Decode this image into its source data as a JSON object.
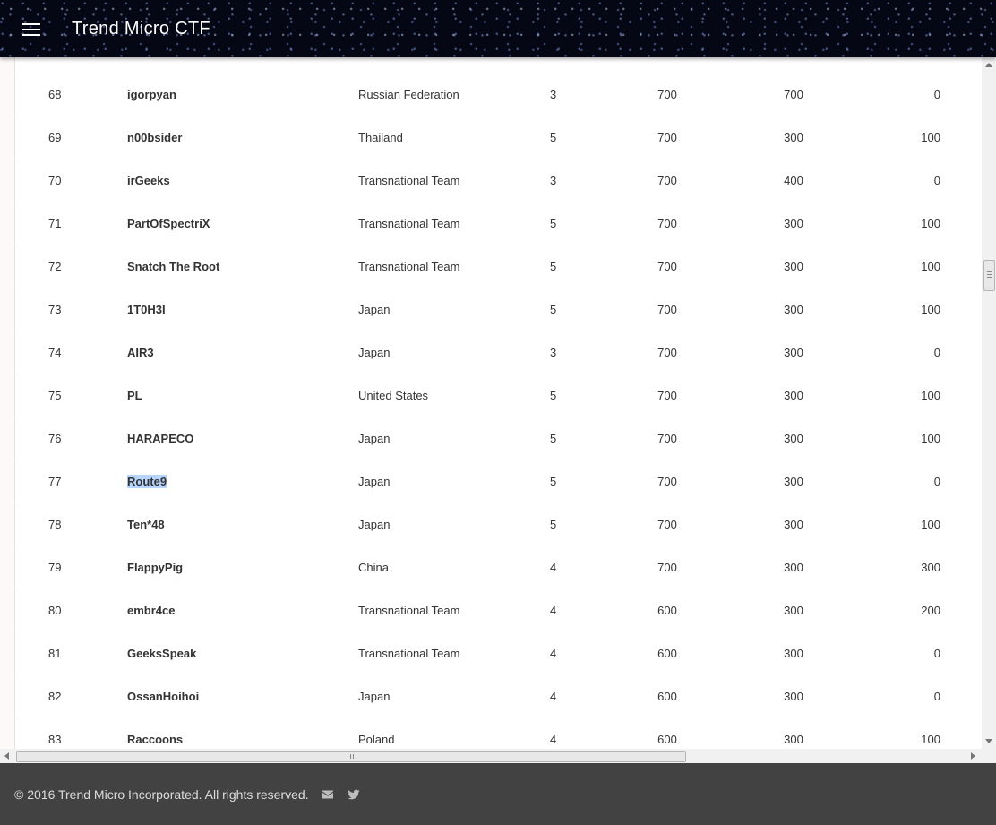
{
  "header": {
    "title": "Trend Micro CTF",
    "menu_icon": "menu-icon"
  },
  "scoreboard": {
    "rows": [
      {
        "rank": "",
        "team": "",
        "country": "",
        "solved": "",
        "a": "",
        "b": "",
        "c": ""
      },
      {
        "rank": "68",
        "team": "igorpyan",
        "country": "Russian Federation",
        "solved": "3",
        "a": "700",
        "b": "700",
        "c": "0"
      },
      {
        "rank": "69",
        "team": "n00bsider",
        "country": "Thailand",
        "solved": "5",
        "a": "700",
        "b": "300",
        "c": "100"
      },
      {
        "rank": "70",
        "team": "irGeeks",
        "country": "Transnational Team",
        "solved": "3",
        "a": "700",
        "b": "400",
        "c": "0"
      },
      {
        "rank": "71",
        "team": "PartOfSpectriX",
        "country": "Transnational Team",
        "solved": "5",
        "a": "700",
        "b": "300",
        "c": "100"
      },
      {
        "rank": "72",
        "team": "Snatch The Root",
        "country": "Transnational Team",
        "solved": "5",
        "a": "700",
        "b": "300",
        "c": "100"
      },
      {
        "rank": "73",
        "team": "1T0H3I",
        "country": "Japan",
        "solved": "5",
        "a": "700",
        "b": "300",
        "c": "100"
      },
      {
        "rank": "74",
        "team": "AIR3",
        "country": "Japan",
        "solved": "3",
        "a": "700",
        "b": "300",
        "c": "0"
      },
      {
        "rank": "75",
        "team": "PL",
        "country": "United States",
        "solved": "5",
        "a": "700",
        "b": "300",
        "c": "100"
      },
      {
        "rank": "76",
        "team": "HARAPECO",
        "country": "Japan",
        "solved": "5",
        "a": "700",
        "b": "300",
        "c": "100"
      },
      {
        "rank": "77",
        "team": "Route9",
        "country": "Japan",
        "solved": "5",
        "a": "700",
        "b": "300",
        "c": "0",
        "selected": true
      },
      {
        "rank": "78",
        "team": "Ten*48",
        "country": "Japan",
        "solved": "5",
        "a": "700",
        "b": "300",
        "c": "100"
      },
      {
        "rank": "79",
        "team": "FlappyPig",
        "country": "China",
        "solved": "4",
        "a": "700",
        "b": "300",
        "c": "300"
      },
      {
        "rank": "80",
        "team": "embr4ce",
        "country": "Transnational Team",
        "solved": "4",
        "a": "600",
        "b": "300",
        "c": "200"
      },
      {
        "rank": "81",
        "team": "GeeksSpeak",
        "country": "Transnational Team",
        "solved": "4",
        "a": "600",
        "b": "300",
        "c": "0"
      },
      {
        "rank": "82",
        "team": "OssanHoihoi",
        "country": "Japan",
        "solved": "4",
        "a": "600",
        "b": "300",
        "c": "0"
      },
      {
        "rank": "83",
        "team": "Raccoons",
        "country": "Poland",
        "solved": "4",
        "a": "600",
        "b": "300",
        "c": "100"
      }
    ]
  },
  "footer": {
    "copyright": "© 2016 Trend Micro Incorporated. All rights reserved.",
    "icons": [
      "mail-icon",
      "twitter-icon"
    ]
  }
}
